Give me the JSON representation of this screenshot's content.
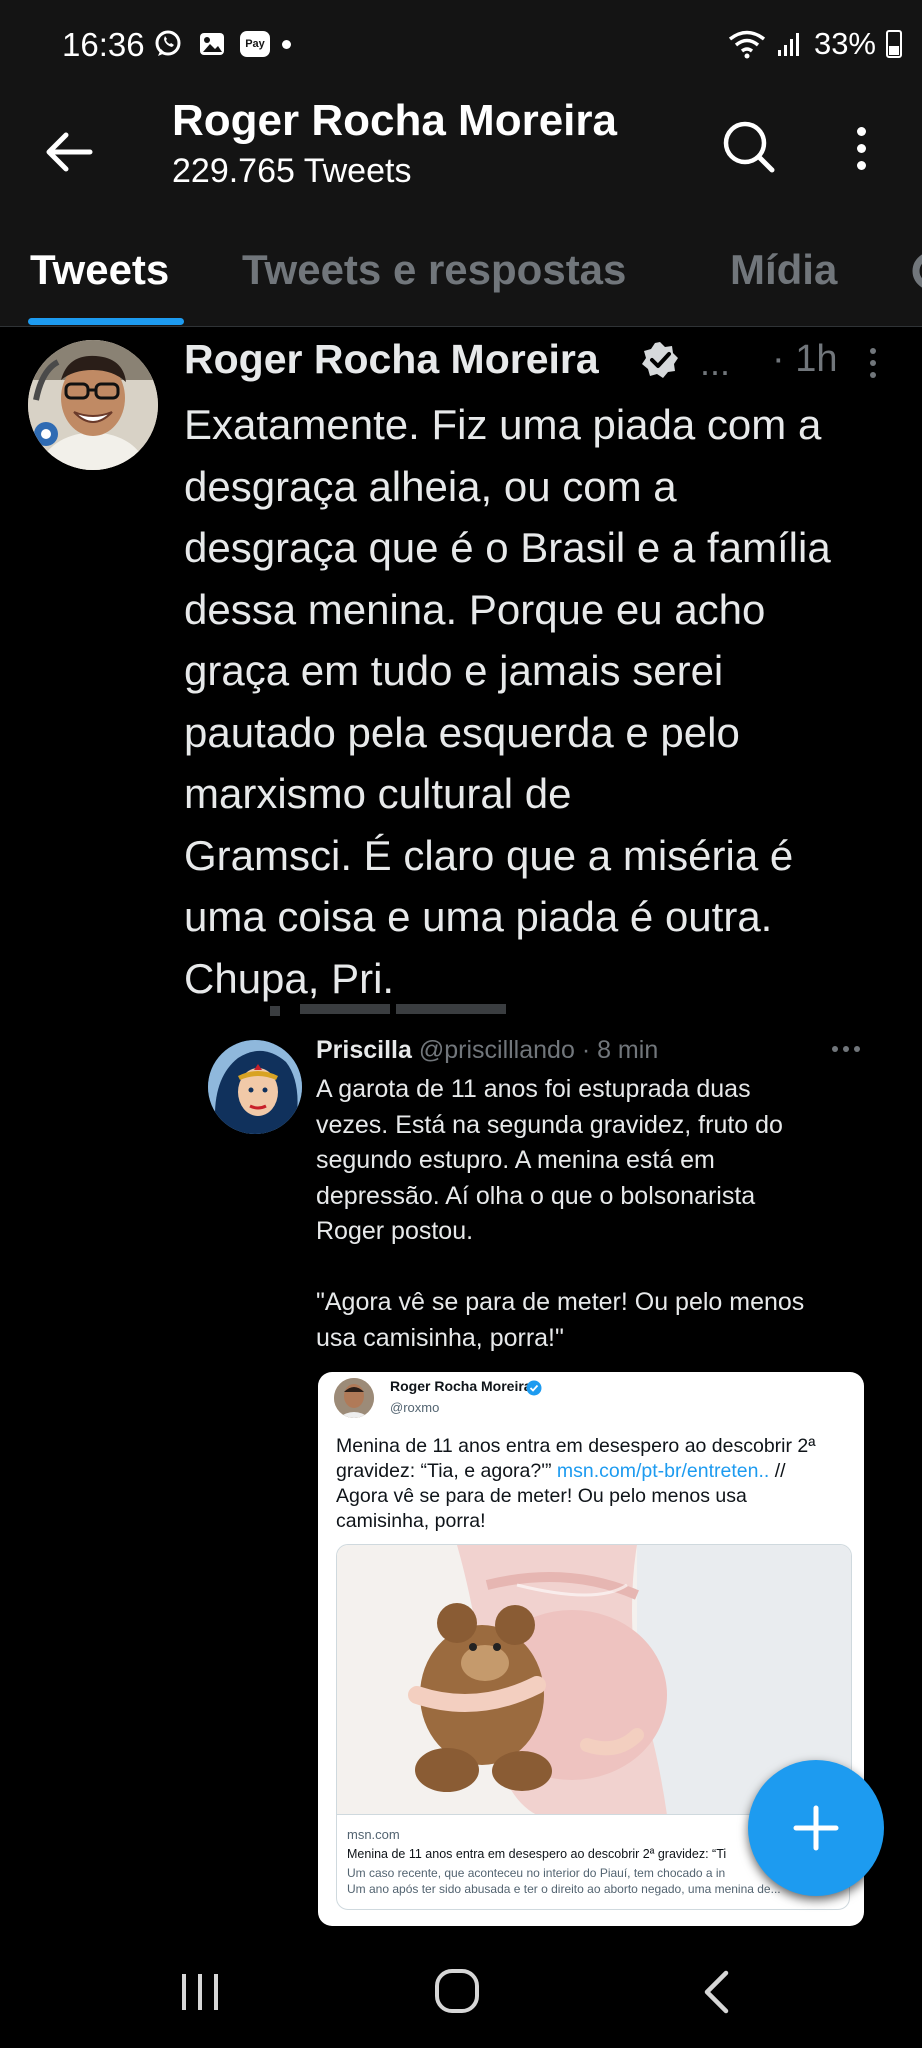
{
  "status_bar": {
    "time": "16:36",
    "pay_label": "Pay",
    "battery": "33%"
  },
  "header": {
    "title": "Roger Rocha Moreira",
    "tweet_count": "229.765 Tweets"
  },
  "tabs": [
    {
      "label": "Tweets",
      "active": true
    },
    {
      "label": "Tweets e respostas",
      "active": false
    },
    {
      "label": "Mídia",
      "active": false
    }
  ],
  "tweet": {
    "author": "Roger Rocha Moreira",
    "ellipsis": "...",
    "time": "· 1h",
    "text_lines": [
      "Exatamente. Fiz uma piada com a",
      "desgraça alheia, ou com a",
      "desgraça que é o Brasil e a família",
      "dessa menina. Porque eu acho",
      "graça em tudo e jamais serei",
      "pautado pela esquerda e pelo",
      "marxismo cultural de",
      "Gramsci. É claro que a miséria é",
      "uma coisa e uma piada é outra.",
      "Chupa, Pri."
    ]
  },
  "quoted": {
    "name": "Priscilla",
    "handle": "@priscilllando",
    "time": "· 8 min",
    "text_lines": [
      "A garota de 11 anos foi estuprada duas",
      "vezes. Está na segunda gravidez, fruto do",
      "segundo estupro. A menina está em",
      "depressão. Aí olha o que o bolsonarista",
      "Roger postou.",
      "",
      "\"Agora vê se para de meter! Ou pelo menos",
      "usa camisinha, porra!\""
    ],
    "card": {
      "name": "Roger Rocha Moreira",
      "handle": "@roxmo",
      "line1": "Menina de 11 anos entra em desespero ao descobrir 2ª",
      "line2_before": "gravidez: “Tia, e agora?'”",
      "line2_link": "msn.com/pt-br/entreten..",
      "line2_after": "//",
      "line3": "Agora vê se para de meter! Ou pelo menos usa",
      "line4": "camisinha, porra!",
      "link_domain": "msn.com",
      "link_title": "Menina de 11 anos entra em desespero ao descobrir 2ª gravidez: “Ti",
      "link_desc1": "Um caso recente, que aconteceu no interior do Piauí, tem chocado a in",
      "link_desc2": "Um ano após ter sido abusada e ter o direito ao aborto negado, uma menina de..."
    }
  },
  "colors": {
    "accent": "#1d9bf0",
    "background": "#000000",
    "secondary_text": "#71767b"
  }
}
